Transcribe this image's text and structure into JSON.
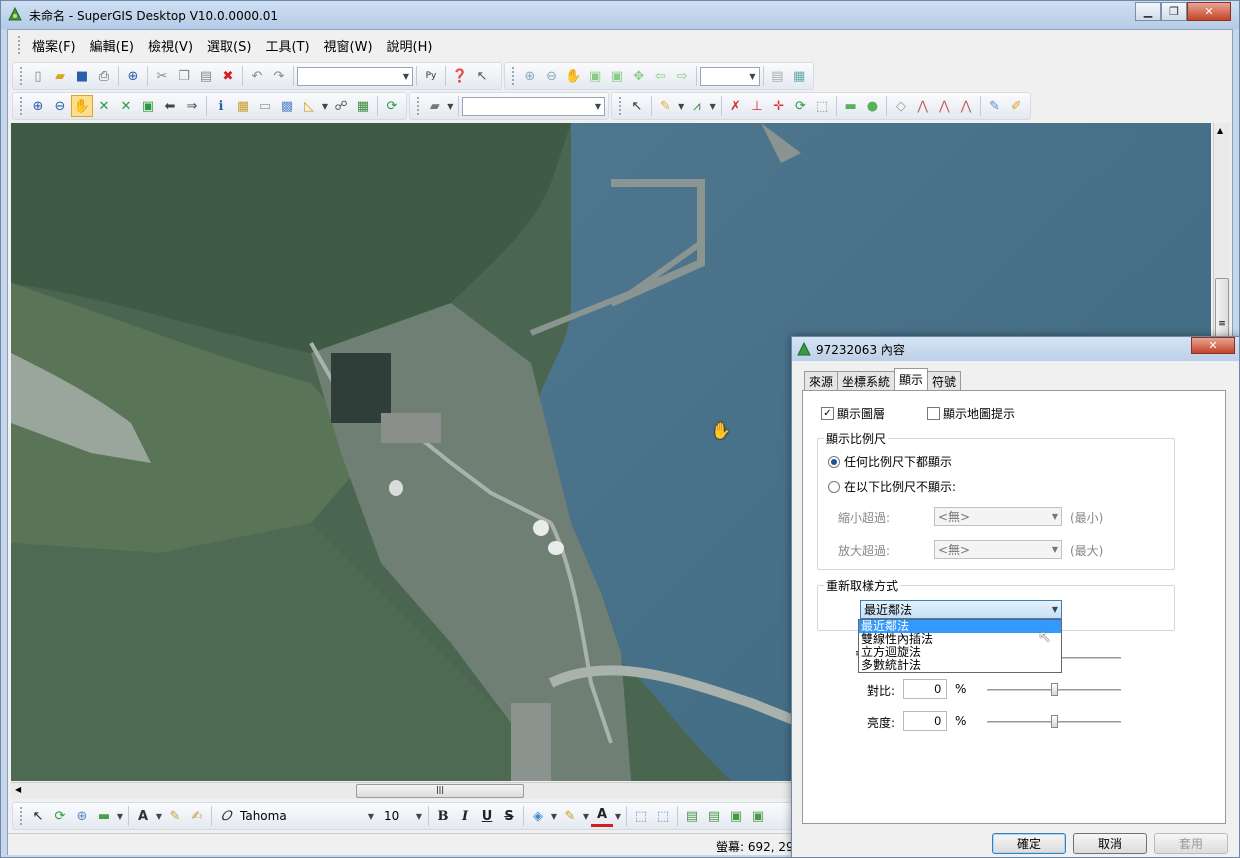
{
  "window": {
    "title": "未命名 - SuperGIS Desktop V10.0.0000.01"
  },
  "menu": [
    "檔案(F)",
    "編輯(E)",
    "檢視(V)",
    "選取(S)",
    "工具(T)",
    "視窗(W)",
    "說明(H)"
  ],
  "toolbar1": {
    "scale_combo": "",
    "zoom_combo": ""
  },
  "toolbar2": {
    "layer_combo": ""
  },
  "drawing_toolbar": {
    "font": "Tahoma",
    "font_size": "10",
    "bold": "B",
    "italic": "I",
    "underline": "U",
    "strike": "S"
  },
  "statusbar": {
    "coords": "螢幕: 692, 29"
  },
  "hscroll_grip": "|||",
  "vscroll_grip": "≡",
  "dialog": {
    "title": "97232063 內容",
    "tabs": [
      "來源",
      "坐標系統",
      "顯示",
      "符號"
    ],
    "active_tab": "顯示",
    "show_layer": {
      "label": "顯示圖層",
      "checked": "✓"
    },
    "show_tips": {
      "label": "顯示地圖提示",
      "checked": ""
    },
    "scale_group": {
      "title": "顯示比例尺",
      "option_any": "任何比例尺下都顯示",
      "option_range": "在以下比例尺不顯示:",
      "min_label": "縮小超過:",
      "min_value": "<無>",
      "min_unit": "(最小)",
      "max_label": "放大超過:",
      "max_value": "<無>",
      "max_unit": "(最大)"
    },
    "resample": {
      "title": "重新取樣方式",
      "selected": "最近鄰法",
      "options": [
        "最近鄰法",
        "雙線性內插法",
        "立方迴旋法",
        "多數統計法"
      ]
    },
    "contrast": {
      "label": "對比:",
      "value": "0",
      "unit": "%",
      "level": 0
    },
    "brightness": {
      "label": "亮度:",
      "value": "0",
      "unit": "%",
      "level": 0
    },
    "buttons": {
      "ok": "確定",
      "cancel": "取消",
      "apply": "套用"
    }
  }
}
